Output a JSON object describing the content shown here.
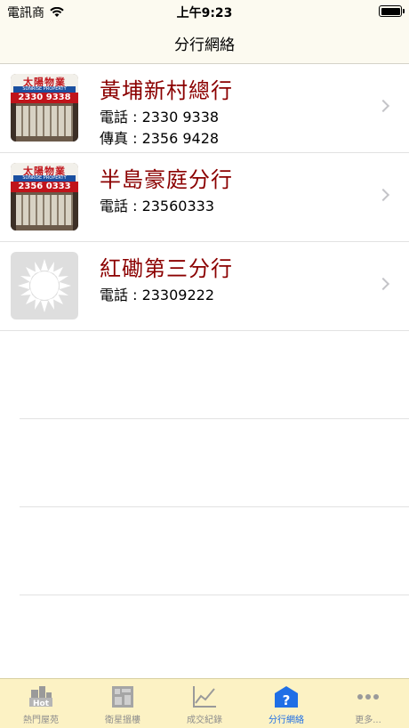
{
  "status": {
    "carrier": "電訊商",
    "time": "上午9:23"
  },
  "nav": {
    "title": "分行網絡"
  },
  "branches": [
    {
      "name": "黃埔新村總行",
      "phone": "電話 : 2330 9338",
      "fax": "傳真 : 2356 9428",
      "thumb": {
        "sign": "太陽物業",
        "band": "SUNRISE PROPERTY",
        "number": "2330 9338"
      }
    },
    {
      "name": "半島豪庭分行",
      "phone": "電話 : 23560333",
      "thumb": {
        "sign": "太陽物業",
        "band": "SUNRISE PROPERTY",
        "number": "2356 0333"
      }
    },
    {
      "name": "紅磡第三分行",
      "phone": "電話 : 23309222"
    }
  ],
  "tabs": [
    {
      "label": "熱門屋苑",
      "icon": "hot-building-icon"
    },
    {
      "label": "衛星搵樓",
      "icon": "satellite-map-icon"
    },
    {
      "label": "成交紀錄",
      "icon": "chart-line-icon"
    },
    {
      "label": "分行網絡",
      "icon": "branch-question-icon"
    },
    {
      "label": "更多...",
      "icon": "more-dots-icon"
    }
  ],
  "colors": {
    "accent": "#1f6fe6",
    "branch_name": "#8b0000",
    "tab_bar": "#fcf2c4",
    "nav_bar": "#fcfaf0"
  }
}
